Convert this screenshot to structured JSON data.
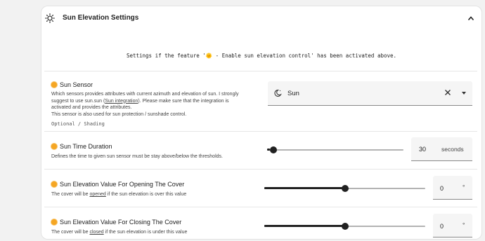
{
  "section": {
    "title": "Sun Elevation Settings",
    "icon": "sun-settings-icon",
    "collapse_icon": "chevron-up-icon"
  },
  "note": "Settings if the feature '🌞 - Enable sun elevation control' has been activated above.",
  "sun_sensor": {
    "label": "Sun Sensor",
    "desc_line1": "Which sensors provides attributes with current azimuth and elevation of sun. I strongly",
    "desc_line2_pre": "suggest to use sun.sun (",
    "desc_link": "Sun integration",
    "desc_line2_post": "). Please make sure that the integration is",
    "desc_line3": "activated and provides the attributes.",
    "desc_line4": "This sensor is also used for sun protection / sunshade control.",
    "path": "Optional / Shading",
    "select_value": "Sun",
    "select_icon": "moon-sun-icon"
  },
  "time_duration": {
    "label": "Sun Time Duration",
    "desc": "Defines the time to given sun sensor must be stay above/below the thresholds.",
    "value": "30",
    "unit": "seconds",
    "slider_fraction": 0.02
  },
  "elev_open": {
    "label": "Sun Elevation Value For Opening The Cover",
    "desc_pre": "The cover will be ",
    "desc_u": "opened",
    "desc_post": " if the sun elevation is over this value",
    "value": "0",
    "unit": "°",
    "slider_fraction": 0.5
  },
  "elev_close": {
    "label": "Sun Elevation Value For Closing The Cover",
    "desc_pre": "The cover will be ",
    "desc_u": "closed",
    "desc_post": " if the sun elevation is under this value",
    "value": "0",
    "unit": "°",
    "slider_fraction": 0.5
  },
  "colors": {
    "accent": "#212121",
    "sun_emoji": "#f5a623",
    "track": "#b3b3b3"
  }
}
